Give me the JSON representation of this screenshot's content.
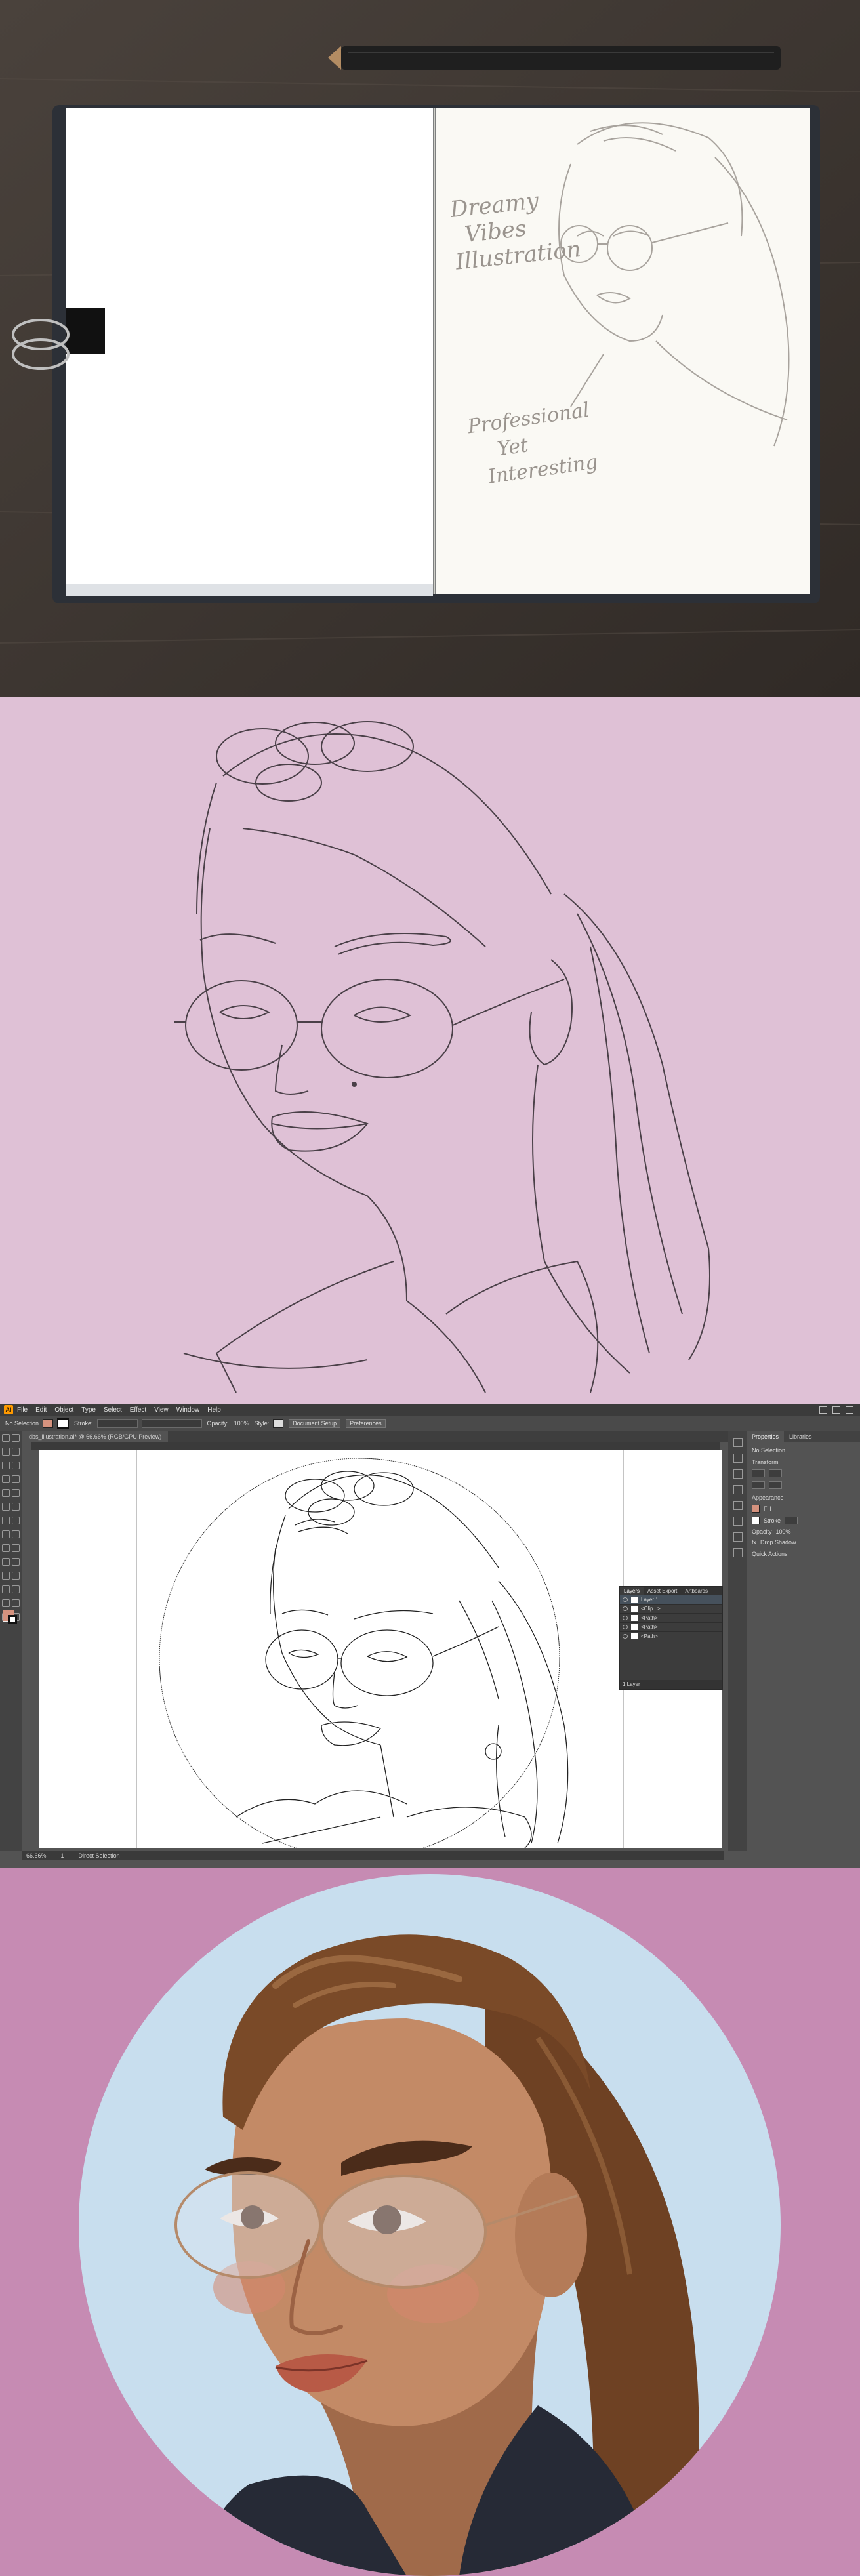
{
  "panels": {
    "sketchbook": {
      "sketch_notes": [
        "Dreamy",
        "Vibes",
        "Illustration",
        "Professional",
        "Yet",
        "Interesting"
      ]
    },
    "illustrator": {
      "app_icon_label": "Ai",
      "menu": [
        "File",
        "Edit",
        "Object",
        "Type",
        "Select",
        "Effect",
        "View",
        "Window",
        "Help"
      ],
      "control_bar": {
        "selection_label": "No Selection",
        "stroke_label": "Stroke:",
        "opacity_label": "Opacity:",
        "opacity_value": "100%",
        "style_label": "Style:",
        "document_setup_button": "Document Setup",
        "preferences_button": "Preferences"
      },
      "document_tab": "dbs_illustration.ai* @ 66.66% (RGB/GPU Preview)",
      "status_bar": {
        "zoom": "66.66%",
        "page": "1",
        "mode": "Direct Selection"
      },
      "properties_panel": {
        "tabs": [
          "Properties",
          "Libraries"
        ],
        "no_selection": "No Selection",
        "transform": "Transform",
        "appearance": "Appearance",
        "fill_label": "Fill",
        "stroke_label": "Stroke",
        "opacity_label": "Opacity",
        "opacity_value": "100%",
        "drop_shadow": "Drop Shadow",
        "quick_actions": "Quick Actions"
      },
      "layers_panel": {
        "tabs": [
          "Layers",
          "Asset Export",
          "Artboards"
        ],
        "layer_name": "Layer 1",
        "sublayers": [
          "<Clip...>",
          "<Path>",
          "<Path>",
          "<Path>"
        ],
        "footer": "1 Layer"
      }
    }
  },
  "colors": {
    "final_background": "#c68bb3",
    "final_circle": "#c8deee",
    "sketch_background": "#dfc1d6",
    "fill_swatch": "#d5927e"
  }
}
